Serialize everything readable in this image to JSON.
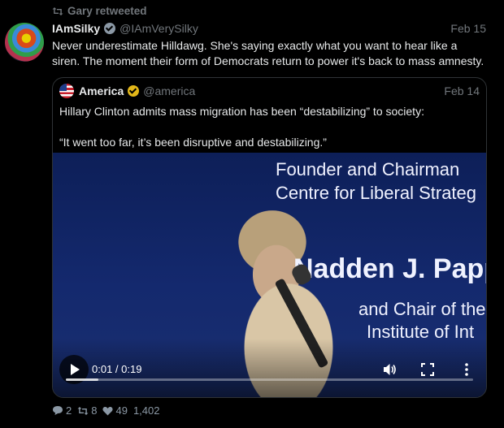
{
  "retweet": {
    "text": "Gary retweeted",
    "icon": "retweet-icon"
  },
  "tweet": {
    "author_name": "IAmSilky",
    "author_handle": "@IAmVerySilky",
    "date": "Feb 15",
    "text": "Never underestimate Hilldawg. She's saying exactly what you want to hear like a siren. The moment their form of Democrats return to power it's back to mass amnesty."
  },
  "quote": {
    "author_name": "America",
    "author_handle": "@america",
    "date": "Feb 14",
    "text_line1": "Hillary Clinton admits mass migration has been “destabilizing” to society:",
    "text_line2": "“It went too far, it’s been disruptive and destabilizing.”"
  },
  "video": {
    "slide_lines": [
      "Founder and Chairman",
      "Centre for Liberal Strateg",
      "Nadden J. Papp",
      "and Chair of the",
      "Institute of Int"
    ],
    "timecode": "0:01 / 0:19",
    "progress_played": 0.0,
    "progress_buffered": 0.08
  },
  "actions": {
    "replies": "2",
    "retweets": "8",
    "likes": "49",
    "views": "1,402"
  },
  "colors": {
    "background": "#000000",
    "text": "#e7e9ea",
    "muted": "#71767b",
    "verified_gold": "#e2b719",
    "verified_gray": "#8b98a5",
    "border": "#2f3336"
  }
}
